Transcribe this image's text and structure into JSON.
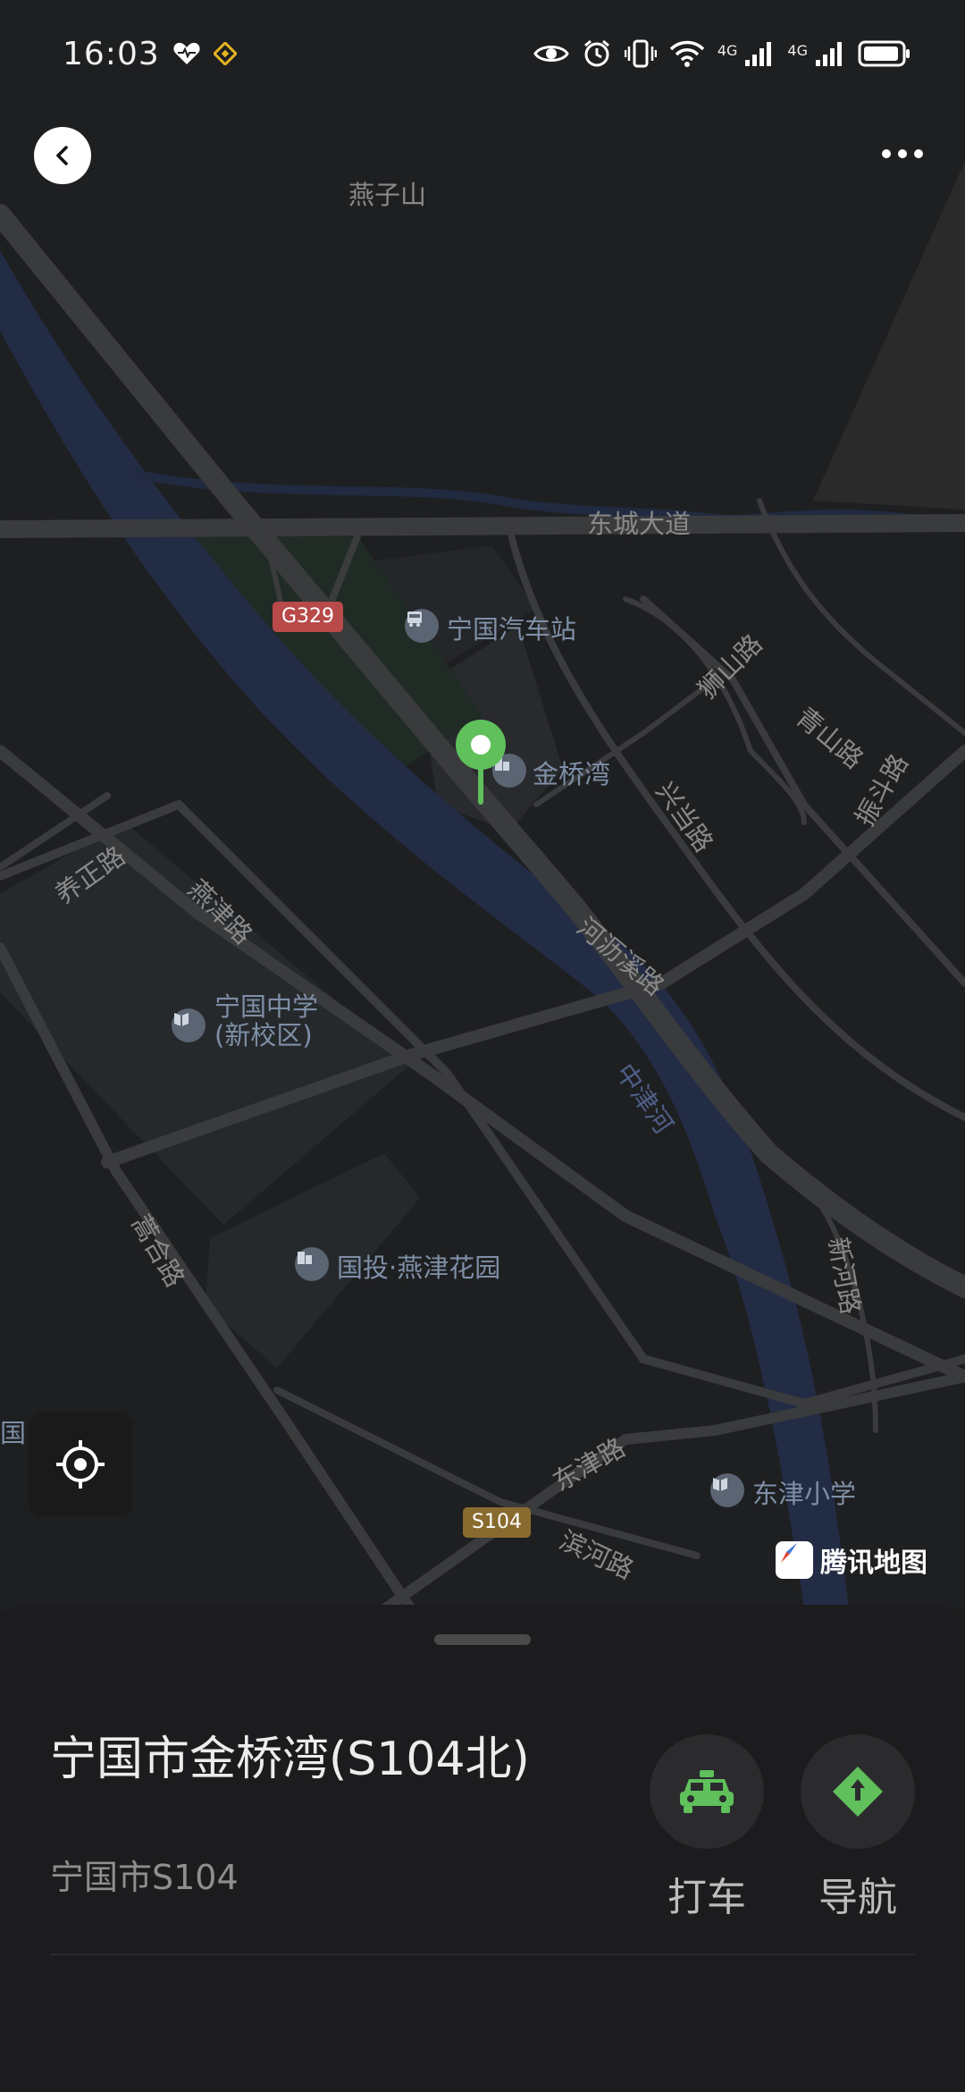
{
  "status_bar": {
    "time": "16:03",
    "net_label_1": "4G",
    "net_label_2": "4G",
    "icons": [
      "heart-pulse-icon",
      "diamond-app-icon",
      "eye-icon",
      "alarm-icon",
      "vibrate-icon",
      "wifi-icon",
      "signal-icon",
      "signal-icon",
      "battery-icon"
    ]
  },
  "map": {
    "labels": {
      "yanzishan": "燕子山",
      "dongcheng": "东城大道",
      "g329": "G329",
      "bus_station": "宁国汽车站",
      "jinqiaowan": "金桥湾",
      "shishan": "狮山路",
      "xingdang": "兴当路",
      "qingshan": "青山路",
      "zhendou": "振斗路",
      "yangzheng": "养正路",
      "yanjin": "燕津路",
      "heli": "河沥溪路",
      "school_1": "宁国中学",
      "school_2": "(新校区)",
      "zhongjin": "中津河",
      "gaohe": "蒿合路",
      "guotou": "国投·燕津花园",
      "xinhe": "新河路",
      "dongjin": "东津路",
      "binhe": "滨河路",
      "dongjin_school": "东津小学",
      "s104": "S104",
      "edge_label": "国"
    },
    "logo": "腾讯地图",
    "colors": {
      "road": "#3a3b3d",
      "river": "#26304a",
      "pin": "#5fc05c",
      "g_shield": "#b84a4a",
      "s_shield": "#8a6b2f"
    }
  },
  "place": {
    "title": "宁国市金桥湾(S104北)",
    "address": "宁国市S104"
  },
  "actions": {
    "taxi": "打车",
    "navigate": "导航"
  }
}
